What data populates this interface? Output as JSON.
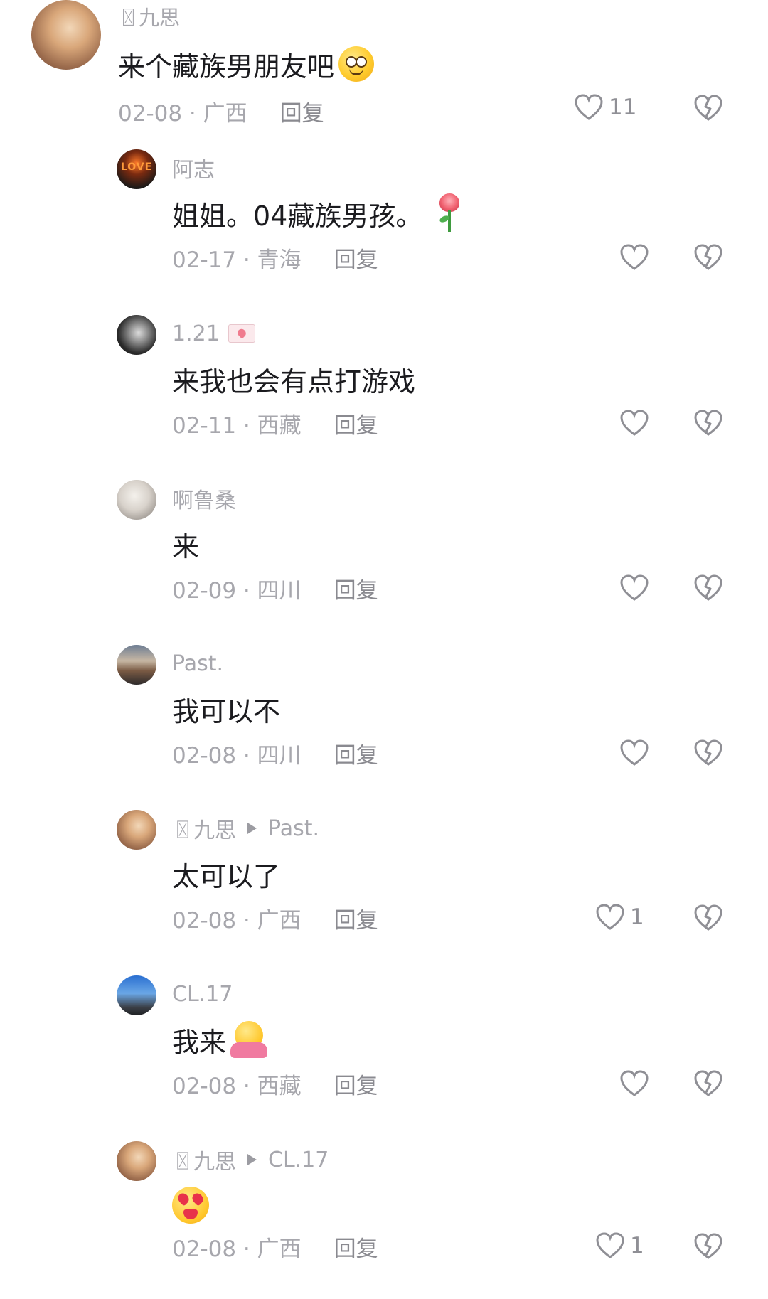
{
  "comments": [
    {
      "username": "〿九思",
      "reply_to": "",
      "text": "来个藏族男朋友吧",
      "emoji": "grinning-squint-emoji",
      "date_location": "02-08 · 广西",
      "reply_label": "回复",
      "like_count": "11"
    },
    {
      "username": "阿志",
      "reply_to": "",
      "text": "姐姐。04藏族男孩。",
      "emoji": "rose-emoji",
      "date_location": "02-17 · 青海",
      "reply_label": "回复",
      "like_count": ""
    },
    {
      "username": "1.21",
      "reply_to": "",
      "text": "来我也会有点打游戏",
      "emoji": "",
      "date_location": "02-11 · 西藏",
      "reply_label": "回复",
      "like_count": ""
    },
    {
      "username": "啊鲁桑",
      "reply_to": "",
      "text": "来",
      "emoji": "",
      "date_location": "02-09 · 四川",
      "reply_label": "回复",
      "like_count": ""
    },
    {
      "username": "Past.",
      "reply_to": "",
      "text": "我可以不",
      "emoji": "",
      "date_location": "02-08 · 四川",
      "reply_label": "回复",
      "like_count": ""
    },
    {
      "username": "〿九思",
      "reply_to": "Past.",
      "text": "太可以了",
      "emoji": "",
      "date_location": "02-08 · 广西",
      "reply_label": "回复",
      "like_count": "1"
    },
    {
      "username": "CL.17",
      "reply_to": "",
      "text": "我来",
      "emoji": "hugging-face-emoji",
      "date_location": "02-08 · 西藏",
      "reply_label": "回复",
      "like_count": ""
    },
    {
      "username": "〿九思",
      "reply_to": "CL.17",
      "text": "",
      "emoji": "heart-eyes-tongue-emoji",
      "date_location": "02-08 · 广西",
      "reply_label": "回复",
      "like_count": "1"
    }
  ],
  "avatars": {
    "second_label": "LOVE"
  },
  "colors": {
    "meta_gray": "#a7a7ad",
    "text_dark": "#1b1b1f",
    "icon_gray": "#8f8f95"
  }
}
